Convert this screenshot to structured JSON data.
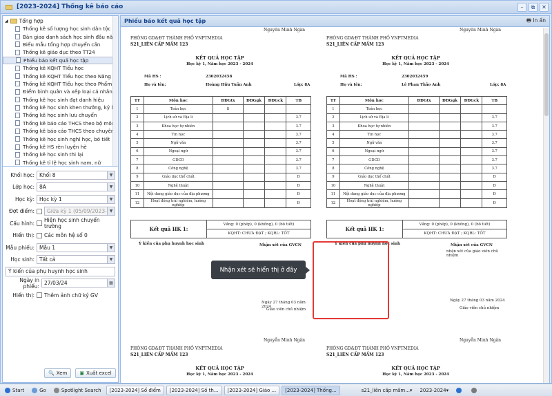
{
  "window": {
    "title": "[2023-2024] Thống kê báo cáo"
  },
  "tree": {
    "root": "Tổng hợp",
    "items": [
      "Thống kê số lượng học sinh dân tộc",
      "Bàn giao danh sách học sinh đầu năm",
      "Biểu mẫu tổng hợp chuyển cấn",
      "Thống kê giáo dục theo TT24",
      "Phiếu báo kết quả học tập",
      "Thống kê KQHT Tiểu học",
      "Thống kê KQHT Tiểu học theo Năng lực",
      "Thống kê KQHT Tiểu học theo Phẩm c...",
      "Điểm bình quân và xếp loại cá nhân",
      "Thống kê học sinh đạt danh hiệu",
      "Thống kê học sinh khen thưởng, kỷ luật",
      "Thống kê học sinh lưu chuyển",
      "Thống kê báo cáo THCS theo bộ môn",
      "Thống kê báo cáo THCS theo chuyên ...",
      "Thống kê học sinh nghỉ học, bỏ tiết",
      "Thống kê HS rèn luyện hè",
      "Thống kê học sinh thi lại",
      "Thống kê tỉ lệ học sinh nam, nữ",
      "Thống kê học sinh lưu ban",
      "Thống kê Tổng hợp điểm cấp tiểu học",
      "Thống kê HS liên kết, FKTTN, TN"
    ],
    "selected_index": 4
  },
  "form": {
    "khoi_label": "Khối học:",
    "khoi_value": "Khối 8",
    "lop_label": "Lớp học:",
    "lop_value": "8A",
    "hocky_label": "Học kỳ:",
    "hocky_value": "Học kỳ 1",
    "dotdiem_label": "Đợt điểm:",
    "dotdiem_value": "Giữa kỳ 1   (05/09/2023->1",
    "cauhinh_label": "Cấu hình:",
    "cauhinh_cb": "Hiện học sinh chuyển trường",
    "hienthi_label": "Hiển thị:",
    "hienthi_cb": "Các môn hệ số 0",
    "maupieu_label": "Mẫu phiếu:",
    "maupieu_value": "Mẫu 1",
    "hocsinh_label": "Học sinh:",
    "hocsinh_value": "Tất cả",
    "ykien": "Ý kiến của phụ huynh học sinh",
    "ngayin_label": "Ngày in phiếu:",
    "ngayin_value": "27/03/24",
    "hienthi2_label": "Hiển thị:",
    "hienthi2_cb": "Thêm ảnh chữ ký GV",
    "xem": "Xem",
    "xuat": "Xuất excel"
  },
  "panel": {
    "title": "Phiếu báo kết quả học tập",
    "print": "In ấn"
  },
  "report": {
    "signer": "Nguyễn Minh Ngân",
    "org": "PHÒNG GD&ĐT THÀNH PHỐ VNPTMEDIA",
    "school": "S21_LIÊN CẤP MẦM 123",
    "title": "KẾT QUẢ HỌC TẬP",
    "sub": "Học kỳ 1, Năm học 2023 - 2024",
    "mahs_label": "Mã HS :",
    "hoten_label": "Họ và tên:",
    "lop_label": "Lớp: 8A",
    "headers": [
      "TT",
      "Môn học",
      "ĐĐGtx",
      "ĐĐGgk",
      "ĐĐGck",
      "TB"
    ],
    "subjects": [
      "Toán học",
      "Lịch sử và Địa lí",
      "Khoa học tự nhiên",
      "Tin học",
      "Ngữ văn",
      "Ngoại ngữ",
      "GDCD",
      "Công nghệ",
      "Giáo dục thể chất",
      "Nghệ thuật",
      "Nội dung giáo dục của địa phương",
      "Hoạt động trải nghiệm, hướng nghiệp"
    ],
    "ketqua": "Kết quả HK 1:",
    "vang": "Vắng: 0 (phép), 0 (không), 0 (bỏ tiết)",
    "kqht": "KQHT: CHƯA ĐẠT ; KQRL: TỐT",
    "ykien_ph": "Ý kiến của phụ huynh học sinh",
    "nhanxet": "Nhận xét của GVCN",
    "nhanxet_sub": "nhận xét của giáo viên chủ nhiệm",
    "ngay": "Ngày 27 tháng 03 năm 2024",
    "gvcn": "Giáo viên chủ nhiệm",
    "students": [
      {
        "mahs": "2302032458",
        "name": "Hoàng Hữu Tuấn Anh",
        "tx1": "8",
        "tb": [
          "",
          "3.7",
          "3.7",
          "3.7",
          "3.7",
          "3.7",
          "3.7",
          "3.7",
          "Đ",
          "Đ",
          "Đ",
          "Đ"
        ]
      },
      {
        "mahs": "2302032459",
        "name": "Lê Phan Thảo Anh",
        "tx1": "",
        "tb": [
          "",
          "3.7",
          "3.7",
          "3.7",
          "3.7",
          "3.7",
          "3.7",
          "3.7",
          "Đ",
          "Đ",
          "Đ",
          "Đ"
        ]
      }
    ]
  },
  "tooltip": "Nhận xét sẽ hiển thị ở đây",
  "taskbar": {
    "start": "Start",
    "go": "Go",
    "spotlight": "Spotlight Search",
    "t1": "[2023-2024] Sổ điểm",
    "t2": "[2023-2024] Số th...",
    "t3": "[2023-2024] Giáo ...",
    "t4": "[2023-2024] Thống...",
    "school": "s21_liên cấp mầm...",
    "year": "2023-2024"
  }
}
